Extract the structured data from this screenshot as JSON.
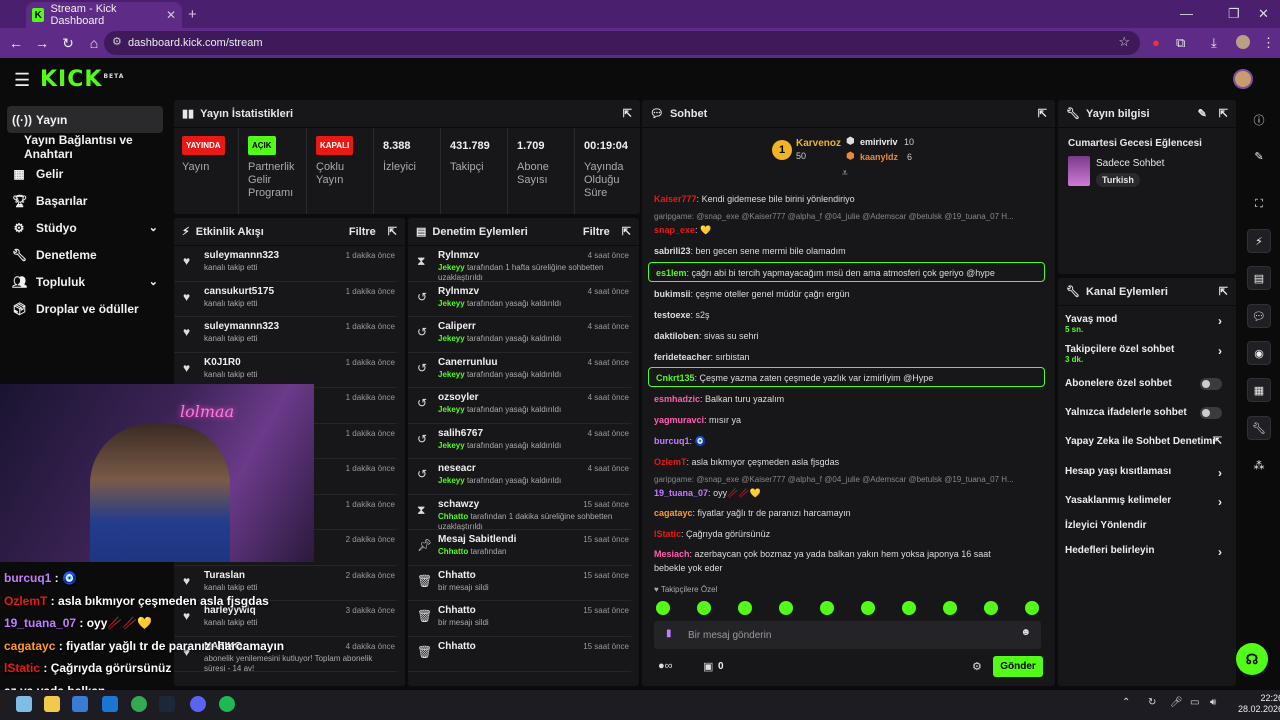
{
  "browser": {
    "tab_title": "Stream - Kick Dashboard",
    "url": "dashboard.kick.com/stream"
  },
  "app": {
    "logo": "KICK",
    "logo_sup": "BETA"
  },
  "sidebar": {
    "items": [
      {
        "label": "Yayın",
        "icon": "broadcast-icon"
      },
      {
        "label": "Yayın Bağlantısı ve Anahtarı",
        "icon": ""
      },
      {
        "label": "Gelir",
        "icon": "revenue-icon"
      },
      {
        "label": "Başarılar",
        "icon": "trophy-icon"
      },
      {
        "label": "Stüdyo",
        "icon": "studio-icon"
      },
      {
        "label": "Denetleme",
        "icon": "wrench-icon"
      },
      {
        "label": "Topluluk",
        "icon": "community-icon"
      },
      {
        "label": "Droplar ve ödüller",
        "icon": "drops-icon"
      }
    ]
  },
  "stats": {
    "title": "Yayın İstatistikleri",
    "status": {
      "badge": "YAYINDA",
      "label": "Yayın",
      "color": "#e91916"
    },
    "partner": {
      "badge": "AÇIK",
      "label": "Partnerlik Gelir Programı",
      "color": "#53fc18"
    },
    "multi": {
      "badge": "KAPALI",
      "label": "Çoklu Yayın",
      "color": "#e91916"
    },
    "viewers": {
      "value": "8.388",
      "label": "İzleyici"
    },
    "followers": {
      "value": "431.789",
      "label": "Takipçi"
    },
    "subs": {
      "value": "1.709",
      "label": "Abone Sayısı"
    },
    "uptime": {
      "value": "00:19:04",
      "label": "Yayında Olduğu Süre"
    }
  },
  "activity": {
    "title": "Etkinlik Akışı",
    "filter": "Filtre",
    "items": [
      {
        "name": "suleymannn323",
        "sub": "kanalı takip etti",
        "time": "1 dakika önce"
      },
      {
        "name": "cansukurt5175",
        "sub": "kanalı takip etti",
        "time": "1 dakika önce"
      },
      {
        "name": "suleymannn323",
        "sub": "kanalı takip etti",
        "time": "1 dakika önce"
      },
      {
        "name": "K0J1R0",
        "sub": "kanalı takip etti",
        "time": "1 dakika önce"
      },
      {
        "name": "",
        "sub": "",
        "time": "1 dakika önce"
      },
      {
        "name": "",
        "sub": "",
        "time": "1 dakika önce"
      },
      {
        "name": "",
        "sub": "",
        "time": "1 dakika önce"
      },
      {
        "name": "",
        "sub": "",
        "time": "1 dakika önce"
      },
      {
        "name": "",
        "sub": "",
        "time": "2 dakika önce"
      },
      {
        "name": "Turaslan",
        "sub": "kanalı takip etti",
        "time": "2 dakika önce"
      },
      {
        "name": "harleyywiq",
        "sub": "kanalı takip etti",
        "time": "3 dakika önce"
      },
      {
        "name": "NAZIKO",
        "sub": "abonelik yenilemesini kutluyor! Toplam abonelik süresi - 14 av!",
        "time": "4 dakika önce"
      }
    ]
  },
  "moderation": {
    "title": "Denetim Eylemleri",
    "filter": "Filtre",
    "items": [
      {
        "name": "Rylnmzv",
        "by": "Jekeyy",
        "sub": "tarafından 1 hafta süreliğine sohbetten uzaklaştırıldı",
        "time": "4 saat önce",
        "icon": "hourglass-icon"
      },
      {
        "name": "Rylnmzv",
        "by": "Jekeyy",
        "sub": "tarafından yasağı kaldırıldı",
        "time": "4 saat önce",
        "icon": "undo-icon"
      },
      {
        "name": "Caliperr",
        "by": "Jekeyy",
        "sub": "tarafından yasağı kaldırıldı",
        "time": "4 saat önce",
        "icon": "undo-icon"
      },
      {
        "name": "Canerrunluu",
        "by": "Jekeyy",
        "sub": "tarafından yasağı kaldırıldı",
        "time": "4 saat önce",
        "icon": "undo-icon"
      },
      {
        "name": "ozsoyler",
        "by": "Jekeyy",
        "sub": "tarafından yasağı kaldırıldı",
        "time": "4 saat önce",
        "icon": "undo-icon"
      },
      {
        "name": "salih6767",
        "by": "Jekeyy",
        "sub": "tarafından yasağı kaldırıldı",
        "time": "4 saat önce",
        "icon": "undo-icon"
      },
      {
        "name": "neseacr",
        "by": "Jekeyy",
        "sub": "tarafından yasağı kaldırıldı",
        "time": "4 saat önce",
        "icon": "undo-icon"
      },
      {
        "name": "schawzy",
        "by": "Chhatto",
        "sub": "tarafından 1 dakika süreliğine sohbetten uzaklaştırıldı",
        "time": "15 saat önce",
        "icon": "hourglass-icon"
      },
      {
        "name": "Mesaj Sabitlendi",
        "by": "Chhatto",
        "sub": "tarafından",
        "time": "15 saat önce",
        "icon": "pin-icon"
      },
      {
        "name": "Chhatto",
        "by": "",
        "sub": "bir mesajı sildi",
        "time": "15 saat önce",
        "icon": "trash-icon"
      },
      {
        "name": "Chhatto",
        "by": "",
        "sub": "bir mesajı sildi",
        "time": "15 saat önce",
        "icon": "trash-icon"
      },
      {
        "name": "Chhatto",
        "by": "",
        "sub": "",
        "time": "15 saat önce",
        "icon": "trash-icon"
      }
    ]
  },
  "chat": {
    "title": "Sohbet",
    "podium": {
      "first": {
        "name": "Karvenoz",
        "score": "50",
        "rank": "1"
      },
      "second": {
        "name": "emirivriv",
        "score": "10"
      },
      "third": {
        "name": "kaanyldz",
        "score": "6"
      }
    },
    "messages": [
      {
        "user": "Kaiser777",
        "text": "Kendi gidemese bile birini yönlendiriyo",
        "color": "#e91916"
      },
      {
        "reply": "garipgame: @snap_exe @Kaiser777 @alpha_f @04_julie @Ademscar @betulsk @19_tuana_07 H..."
      },
      {
        "user": "snap_exe",
        "text": "💛",
        "color": "#e91916"
      },
      {
        "user": "sabrili23",
        "text": "ben gecen sene mermi bile olamadım",
        "color": "#dddddd"
      },
      {
        "user": "es1lem",
        "text": "çağrı abi bi tercih yapmayacağım msü den ama atmosferi çok geriyo @hype",
        "color": "#53fc18",
        "highlight": true
      },
      {
        "user": "bukimsii",
        "text": "çeşme oteller genel müdür çağrı ergün",
        "color": "#dddddd"
      },
      {
        "user": "testoexe",
        "text": "s2ş",
        "color": "#dddddd"
      },
      {
        "user": "daktiloben",
        "text": "sivas su sehri",
        "color": "#dddddd"
      },
      {
        "user": "ferideteacher",
        "text": "sırbistan",
        "color": "#dddddd"
      },
      {
        "user": "Cnkrt135",
        "text": "Çeşme yazma zaten çeşmede yazlık var izmirliyim @Hype",
        "color": "#53fc18",
        "highlight": true
      },
      {
        "user": "esmhadzic",
        "text": "Balkan turu yazalım",
        "color": "#ff5fae"
      },
      {
        "user": "yagmuravci",
        "text": "mısır ya",
        "color": "#ff5fae"
      },
      {
        "user": "burcuq1",
        "text": "🧿",
        "color": "#c57cff"
      },
      {
        "user": "OzlemT",
        "text": "asla bıkmıyor çeşmeden asla fjsgdas",
        "color": "#e91916"
      },
      {
        "reply": "garipgame: @snap_exe @Kaiser777 @alpha_f @04_julie @Ademscar @betulsk @19_tuana_07 H..."
      },
      {
        "user": "19_tuana_07",
        "text": "oyy🥢🥢💛",
        "color": "#c57cff"
      },
      {
        "user": "cagatayc",
        "text": "fiyatlar yağlı tr de paranızı harcamayın",
        "color": "#ff9a2e"
      },
      {
        "user": "lStatic",
        "text": "Çağrıyda görürsünüz",
        "color": "#e91916"
      },
      {
        "user": "Mesiach",
        "text": "azerbaycan çok bozmaz ya yada balkan yakın hem yoksa japonya 16 saat",
        "color": "#ff5fae"
      },
      {
        "text_cont": "bebekle yok eder"
      }
    ],
    "followers_only": "Takipçilere Özel",
    "input_placeholder": "Bir mesaj gönderin",
    "points": "0",
    "send_label": "Gönder"
  },
  "info": {
    "title": "Yayın bilgisi",
    "stream_title": "Cumartesi Gecesi Eğlencesi",
    "category": "Sadece Sohbet",
    "language": "Turkish"
  },
  "actions": {
    "title": "Kanal Eylemleri",
    "items": [
      {
        "label": "Yavaş mod",
        "sub": "5 sn.",
        "ctrl": "chevron"
      },
      {
        "label": "Takipçilere özel sohbet",
        "sub": "3 dk.",
        "ctrl": "chevron"
      },
      {
        "label": "Abonelere özel sohbet",
        "sub": "",
        "ctrl": "toggle"
      },
      {
        "label": "Yalnızca ifadelerle sohbet",
        "sub": "",
        "ctrl": "toggle"
      },
      {
        "label": "Yapay Zeka ile Sohbet Denetimi",
        "sub": "",
        "ctrl": "external"
      },
      {
        "label": "Hesap yaşı kısıtlaması",
        "sub": "",
        "ctrl": "chevron"
      },
      {
        "label": "Yasaklanmış kelimeler",
        "sub": "",
        "ctrl": "chevron"
      },
      {
        "label": "İzleyici Yönlendir",
        "sub": "",
        "ctrl": ""
      },
      {
        "label": "Hedefleri belirleyin",
        "sub": "",
        "ctrl": "chevron"
      }
    ]
  },
  "overlay": {
    "neon": "lolmaa",
    "messages": [
      {
        "user": "burcuq1",
        "text": "🧿",
        "color": "#c57cff"
      },
      {
        "user": "OzlemT",
        "text": "asla bıkmıyor çeşmeden asla fjsgdas",
        "color": "#e91916"
      },
      {
        "user": "19_tuana_07",
        "text": "oyy🥢🥢💛",
        "color": "#c57cff"
      },
      {
        "user": "cagatayc",
        "text": "fiyatlar yağlı tr de paranızı harcamayın",
        "color": "#ff9a2e"
      },
      {
        "user": "lStatic",
        "text": "Çağrıyda görürsünüz",
        "color": "#e91916"
      },
      {
        "user": "",
        "text": "az ya yada balkan",
        "color": "#ffffff"
      },
      {
        "user": "",
        "text": "bebekle yok eder",
        "color": "#ffffff"
      }
    ]
  },
  "taskbar": {
    "time": "22:26",
    "date": "28.02.2026"
  }
}
